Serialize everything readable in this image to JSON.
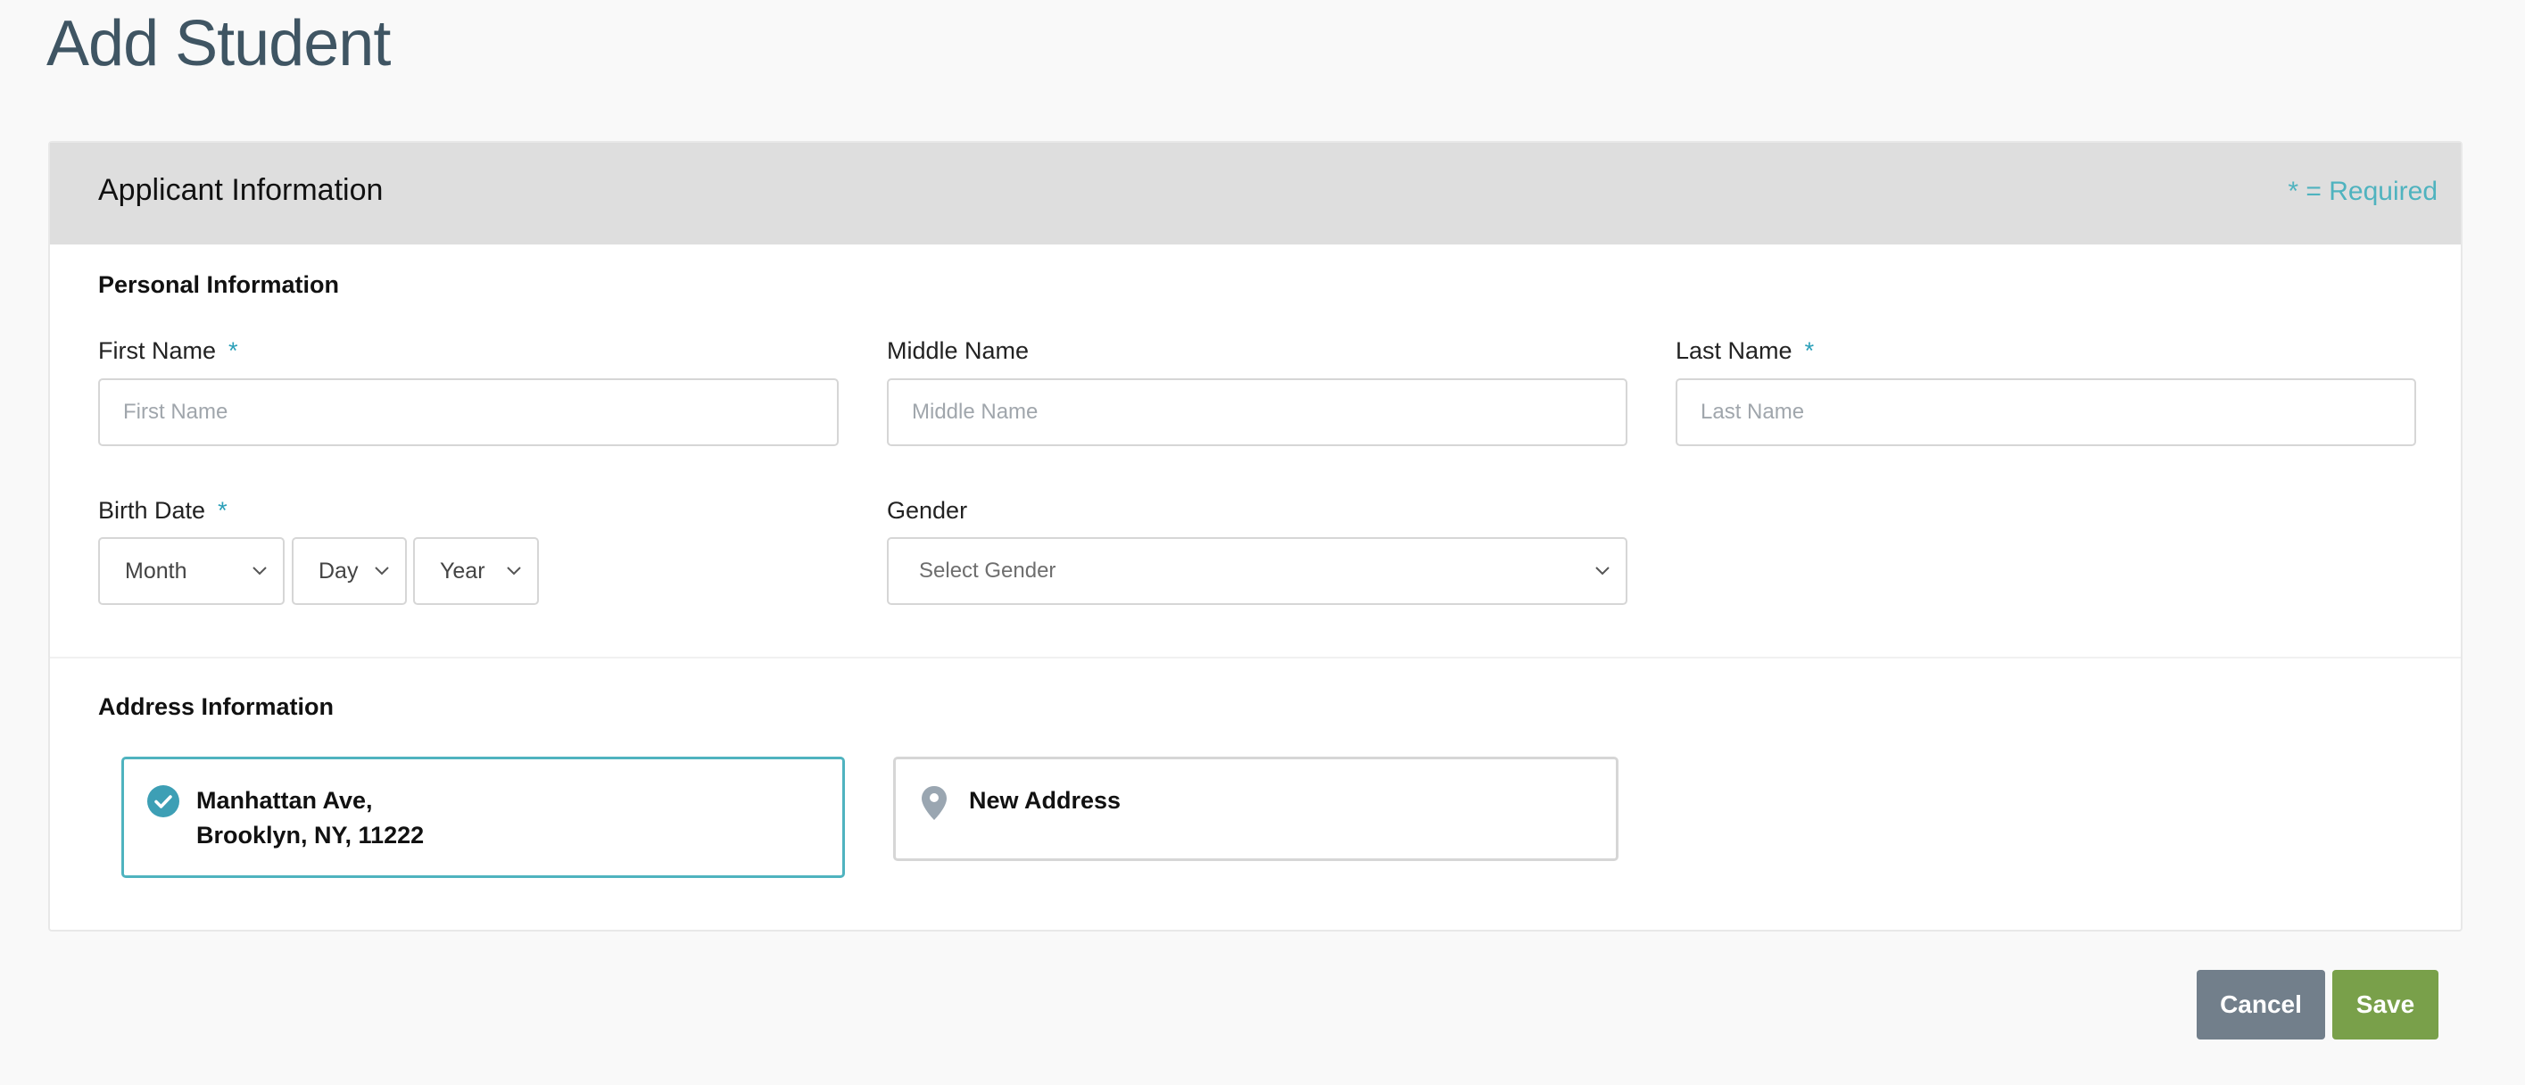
{
  "page": {
    "title": "Add Student"
  },
  "card": {
    "title": "Applicant Information",
    "required_note": "* = Required"
  },
  "personal": {
    "section_title": "Personal Information",
    "first_name": {
      "label": "First Name",
      "required": "*",
      "placeholder": "First Name",
      "value": ""
    },
    "middle_name": {
      "label": "Middle Name",
      "placeholder": "Middle Name",
      "value": ""
    },
    "last_name": {
      "label": "Last Name",
      "required": "*",
      "placeholder": "Last Name",
      "value": ""
    },
    "birth_date": {
      "label": "Birth Date",
      "required": "*",
      "month": "Month",
      "day": "Day",
      "year": "Year"
    },
    "gender": {
      "label": "Gender",
      "value": "Select Gender"
    }
  },
  "address": {
    "section_title": "Address Information",
    "saved": {
      "line1": "Manhattan Ave,",
      "line2": "Brooklyn, NY, 11222",
      "icon": "check-circle-icon"
    },
    "new": {
      "label": "New Address",
      "icon": "map-pin-icon"
    }
  },
  "actions": {
    "cancel_label": "Cancel",
    "save_label": "Save"
  },
  "colors": {
    "accent": "#4fb3bf",
    "required_star": "#2a9fb8",
    "cancel_bg": "#727f8b",
    "save_bg": "#79a04a",
    "header_bg": "#dedede"
  }
}
